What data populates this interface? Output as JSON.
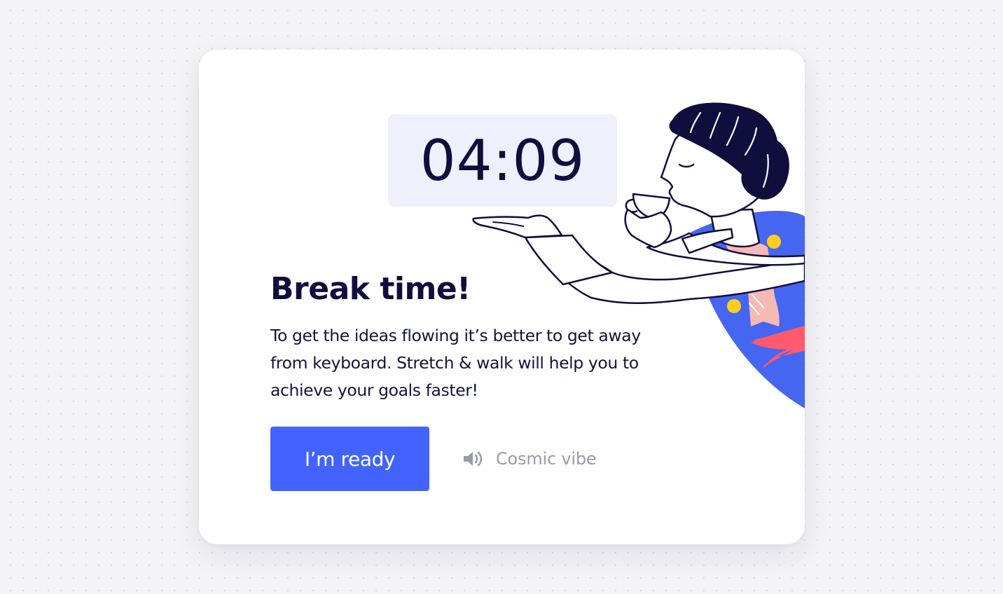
{
  "timer": {
    "value": "04:09"
  },
  "break_card": {
    "title": "Break time!",
    "description": "To get the ideas flowing it’s better to get away from keyboard. Stretch & walk will help you to achieve your goals faster!",
    "ready_button_label": "I’m ready",
    "music_label": "Cosmic vibe",
    "music_icon": "speaker-icon"
  },
  "colors": {
    "accent": "#4263ff",
    "text_dark": "#0f0e3d",
    "timer_bg": "#eef0fc",
    "muted": "#9a9aae",
    "shirt": "#4466f0",
    "scarf": "#f7b9b4",
    "stripe": "#ff5a6e",
    "dots": "#ffcd1e"
  }
}
